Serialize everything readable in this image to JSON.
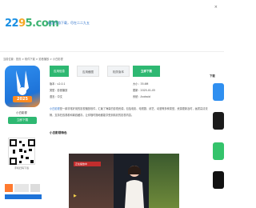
{
  "header": {
    "logo_part1": "22",
    "logo_part2": "9",
    "logo_part3": "5.com",
    "slogan": "精品手游下载，尽在二二九五",
    "close_label": "×"
  },
  "breadcrumb": "当前位置：首页 > 软件下载 > 影音播放 > 小白影视",
  "app": {
    "name": "小白影视",
    "year_badge": "2025",
    "download_label": "立即下载",
    "qr_label": "手机扫码下载"
  },
  "tabs": [
    {
      "label": "应用信息"
    },
    {
      "label": "应用截图"
    },
    {
      "label": "相关版本"
    },
    {
      "label": "立即下载"
    }
  ],
  "info": {
    "row1_left": "版本：v2.0.1",
    "row1_right": "大小：35.6M",
    "row2_left": "类型：影音播放",
    "row2_right": "更新：2025-01-05",
    "row3_left": "语言：中文",
    "row3_right": "系统：Android"
  },
  "description": {
    "lead": "小白影视",
    "text": "是一款非常好用的影视播放软件，汇聚了海量的影视资源，包括电影、电视剧、综艺、动漫等多种类型，资源更新及时，画质高清流畅，支持在线观看和离线缓存，让你随时随地都能享受到精彩的影视内容。"
  },
  "section": {
    "title": "小白影视特色"
  },
  "video": {
    "tag": "正在播放中"
  },
  "right_rail": {
    "label": "下载"
  },
  "colors": {
    "accent_green": "#2eb872",
    "brand_blue": "#1e73d8",
    "orange": "#ff8a1f"
  }
}
